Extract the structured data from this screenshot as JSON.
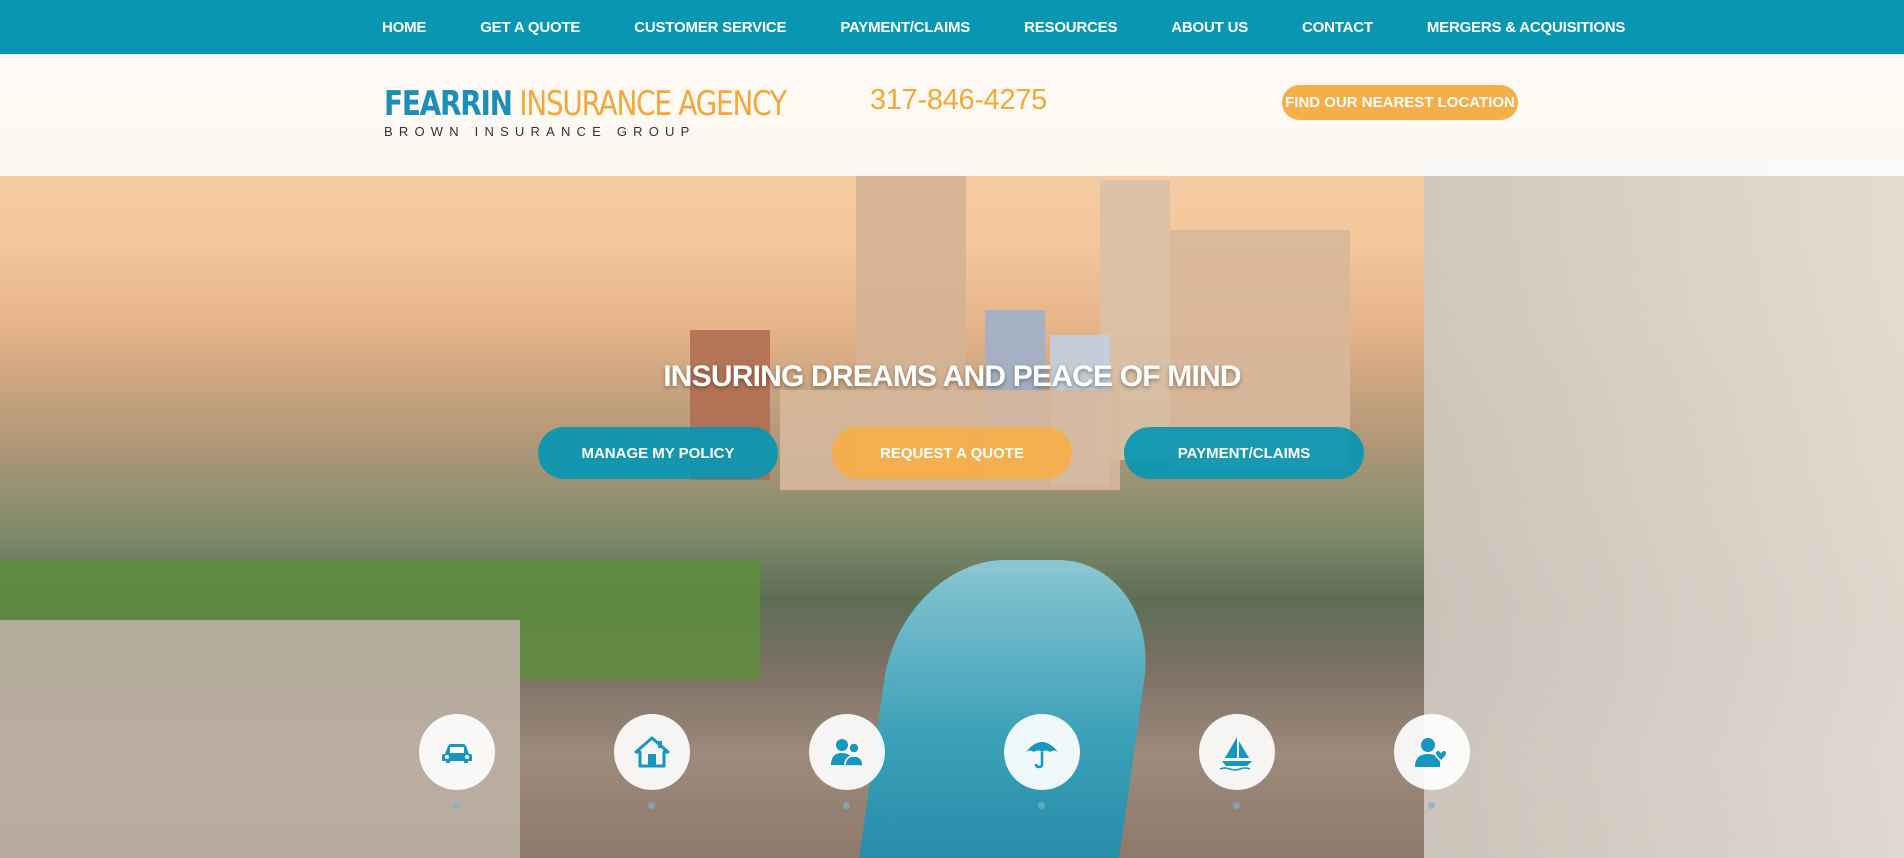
{
  "nav": {
    "items": [
      "HOME",
      "GET A QUOTE",
      "CUSTOMER SERVICE",
      "PAYMENT/CLAIMS",
      "RESOURCES",
      "ABOUT US",
      "CONTACT",
      "MERGERS & ACQUISITIONS"
    ]
  },
  "header": {
    "logo_word1": "FEARRIN",
    "logo_word2": "INSURANCE AGENCY",
    "logo_sub": "BROWN INSURANCE GROUP",
    "phone": "317-846-4275",
    "locate_label": "FIND OUR NEAREST LOCATION"
  },
  "hero": {
    "tagline": "INSURING DREAMS AND PEACE OF MIND",
    "manage_label": "MANAGE MY POLICY",
    "quote_label": "REQUEST A QUOTE",
    "payment_label": "PAYMENT/CLAIMS"
  },
  "icons": [
    "car-icon",
    "home-icon",
    "business-people-icon",
    "umbrella-icon",
    "boat-icon",
    "health-life-icon"
  ],
  "colors": {
    "brand_teal": "#0896b3",
    "brand_orange": "#f6ae4b",
    "white": "#ffffff"
  }
}
